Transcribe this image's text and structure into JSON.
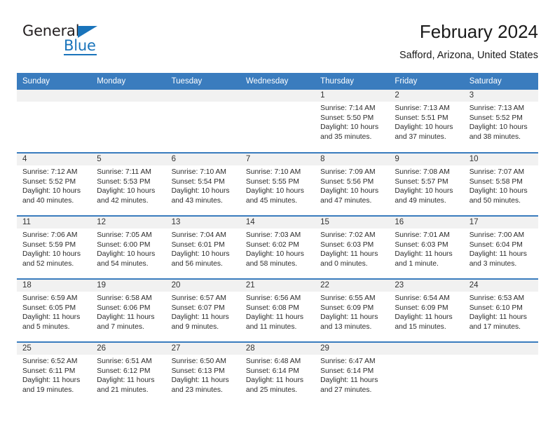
{
  "brand": {
    "name_part1": "General",
    "name_part2": "Blue",
    "logo_icon": "triangle-flag-icon"
  },
  "header": {
    "title": "February 2024",
    "subtitle": "Safford, Arizona, United States"
  },
  "colors": {
    "header_blue": "#3a7cbe",
    "brand_blue": "#1a74bb",
    "daynum_band": "#f1f1f1",
    "text": "#1a1a1a"
  },
  "weekdays": [
    "Sunday",
    "Monday",
    "Tuesday",
    "Wednesday",
    "Thursday",
    "Friday",
    "Saturday"
  ],
  "weeks": [
    [
      {
        "day": "",
        "empty": true
      },
      {
        "day": "",
        "empty": true
      },
      {
        "day": "",
        "empty": true
      },
      {
        "day": "",
        "empty": true
      },
      {
        "day": "1",
        "sunrise": "Sunrise: 7:14 AM",
        "sunset": "Sunset: 5:50 PM",
        "daylight1": "Daylight: 10 hours",
        "daylight2": "and 35 minutes."
      },
      {
        "day": "2",
        "sunrise": "Sunrise: 7:13 AM",
        "sunset": "Sunset: 5:51 PM",
        "daylight1": "Daylight: 10 hours",
        "daylight2": "and 37 minutes."
      },
      {
        "day": "3",
        "sunrise": "Sunrise: 7:13 AM",
        "sunset": "Sunset: 5:52 PM",
        "daylight1": "Daylight: 10 hours",
        "daylight2": "and 38 minutes."
      }
    ],
    [
      {
        "day": "4",
        "sunrise": "Sunrise: 7:12 AM",
        "sunset": "Sunset: 5:52 PM",
        "daylight1": "Daylight: 10 hours",
        "daylight2": "and 40 minutes."
      },
      {
        "day": "5",
        "sunrise": "Sunrise: 7:11 AM",
        "sunset": "Sunset: 5:53 PM",
        "daylight1": "Daylight: 10 hours",
        "daylight2": "and 42 minutes."
      },
      {
        "day": "6",
        "sunrise": "Sunrise: 7:10 AM",
        "sunset": "Sunset: 5:54 PM",
        "daylight1": "Daylight: 10 hours",
        "daylight2": "and 43 minutes."
      },
      {
        "day": "7",
        "sunrise": "Sunrise: 7:10 AM",
        "sunset": "Sunset: 5:55 PM",
        "daylight1": "Daylight: 10 hours",
        "daylight2": "and 45 minutes."
      },
      {
        "day": "8",
        "sunrise": "Sunrise: 7:09 AM",
        "sunset": "Sunset: 5:56 PM",
        "daylight1": "Daylight: 10 hours",
        "daylight2": "and 47 minutes."
      },
      {
        "day": "9",
        "sunrise": "Sunrise: 7:08 AM",
        "sunset": "Sunset: 5:57 PM",
        "daylight1": "Daylight: 10 hours",
        "daylight2": "and 49 minutes."
      },
      {
        "day": "10",
        "sunrise": "Sunrise: 7:07 AM",
        "sunset": "Sunset: 5:58 PM",
        "daylight1": "Daylight: 10 hours",
        "daylight2": "and 50 minutes."
      }
    ],
    [
      {
        "day": "11",
        "sunrise": "Sunrise: 7:06 AM",
        "sunset": "Sunset: 5:59 PM",
        "daylight1": "Daylight: 10 hours",
        "daylight2": "and 52 minutes."
      },
      {
        "day": "12",
        "sunrise": "Sunrise: 7:05 AM",
        "sunset": "Sunset: 6:00 PM",
        "daylight1": "Daylight: 10 hours",
        "daylight2": "and 54 minutes."
      },
      {
        "day": "13",
        "sunrise": "Sunrise: 7:04 AM",
        "sunset": "Sunset: 6:01 PM",
        "daylight1": "Daylight: 10 hours",
        "daylight2": "and 56 minutes."
      },
      {
        "day": "14",
        "sunrise": "Sunrise: 7:03 AM",
        "sunset": "Sunset: 6:02 PM",
        "daylight1": "Daylight: 10 hours",
        "daylight2": "and 58 minutes."
      },
      {
        "day": "15",
        "sunrise": "Sunrise: 7:02 AM",
        "sunset": "Sunset: 6:03 PM",
        "daylight1": "Daylight: 11 hours",
        "daylight2": "and 0 minutes."
      },
      {
        "day": "16",
        "sunrise": "Sunrise: 7:01 AM",
        "sunset": "Sunset: 6:03 PM",
        "daylight1": "Daylight: 11 hours",
        "daylight2": "and 1 minute."
      },
      {
        "day": "17",
        "sunrise": "Sunrise: 7:00 AM",
        "sunset": "Sunset: 6:04 PM",
        "daylight1": "Daylight: 11 hours",
        "daylight2": "and 3 minutes."
      }
    ],
    [
      {
        "day": "18",
        "sunrise": "Sunrise: 6:59 AM",
        "sunset": "Sunset: 6:05 PM",
        "daylight1": "Daylight: 11 hours",
        "daylight2": "and 5 minutes."
      },
      {
        "day": "19",
        "sunrise": "Sunrise: 6:58 AM",
        "sunset": "Sunset: 6:06 PM",
        "daylight1": "Daylight: 11 hours",
        "daylight2": "and 7 minutes."
      },
      {
        "day": "20",
        "sunrise": "Sunrise: 6:57 AM",
        "sunset": "Sunset: 6:07 PM",
        "daylight1": "Daylight: 11 hours",
        "daylight2": "and 9 minutes."
      },
      {
        "day": "21",
        "sunrise": "Sunrise: 6:56 AM",
        "sunset": "Sunset: 6:08 PM",
        "daylight1": "Daylight: 11 hours",
        "daylight2": "and 11 minutes."
      },
      {
        "day": "22",
        "sunrise": "Sunrise: 6:55 AM",
        "sunset": "Sunset: 6:09 PM",
        "daylight1": "Daylight: 11 hours",
        "daylight2": "and 13 minutes."
      },
      {
        "day": "23",
        "sunrise": "Sunrise: 6:54 AM",
        "sunset": "Sunset: 6:09 PM",
        "daylight1": "Daylight: 11 hours",
        "daylight2": "and 15 minutes."
      },
      {
        "day": "24",
        "sunrise": "Sunrise: 6:53 AM",
        "sunset": "Sunset: 6:10 PM",
        "daylight1": "Daylight: 11 hours",
        "daylight2": "and 17 minutes."
      }
    ],
    [
      {
        "day": "25",
        "sunrise": "Sunrise: 6:52 AM",
        "sunset": "Sunset: 6:11 PM",
        "daylight1": "Daylight: 11 hours",
        "daylight2": "and 19 minutes."
      },
      {
        "day": "26",
        "sunrise": "Sunrise: 6:51 AM",
        "sunset": "Sunset: 6:12 PM",
        "daylight1": "Daylight: 11 hours",
        "daylight2": "and 21 minutes."
      },
      {
        "day": "27",
        "sunrise": "Sunrise: 6:50 AM",
        "sunset": "Sunset: 6:13 PM",
        "daylight1": "Daylight: 11 hours",
        "daylight2": "and 23 minutes."
      },
      {
        "day": "28",
        "sunrise": "Sunrise: 6:48 AM",
        "sunset": "Sunset: 6:14 PM",
        "daylight1": "Daylight: 11 hours",
        "daylight2": "and 25 minutes."
      },
      {
        "day": "29",
        "sunrise": "Sunrise: 6:47 AM",
        "sunset": "Sunset: 6:14 PM",
        "daylight1": "Daylight: 11 hours",
        "daylight2": "and 27 minutes."
      },
      {
        "day": "",
        "empty": true
      },
      {
        "day": "",
        "empty": true
      }
    ]
  ]
}
